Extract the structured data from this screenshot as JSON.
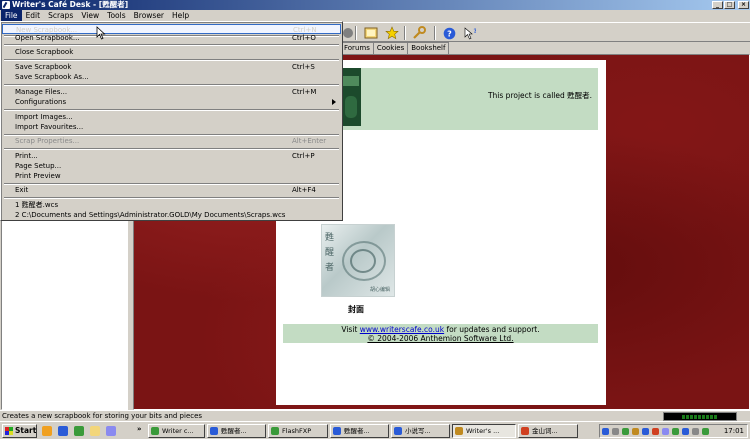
{
  "window": {
    "title": "Writer's Café Desk - [甦醒者]",
    "minimize": "_",
    "maximize": "□",
    "close": "×"
  },
  "menubar": [
    "File",
    "Edit",
    "Scraps",
    "View",
    "Tools",
    "Browser",
    "Help"
  ],
  "toolbar": {
    "icons": [
      "new-icon",
      "note-icon",
      "star-icon",
      "wrench-icon",
      "help-icon",
      "whats-this-icon"
    ]
  },
  "tabs": [
    "Forums",
    "Cookies",
    "Bookshelf"
  ],
  "file_menu": {
    "items": [
      {
        "label": "New Scrapbook...",
        "shortcut": "Ctrl+N"
      },
      {
        "label": "Open Scrapbook...",
        "shortcut": "Ctrl+O"
      },
      {
        "label": "Close Scrapbook",
        "shortcut": ""
      },
      {
        "label": "Save Scrapbook",
        "shortcut": "Ctrl+S"
      },
      {
        "label": "Save Scrapbook As...",
        "shortcut": ""
      },
      {
        "label": "Manage Files...",
        "shortcut": "Ctrl+M"
      },
      {
        "label": "Configurations",
        "shortcut": ""
      },
      {
        "label": "Import Images...",
        "shortcut": ""
      },
      {
        "label": "Import Favourites...",
        "shortcut": ""
      },
      {
        "label": "Scrap Properties...",
        "shortcut": "Alt+Enter"
      },
      {
        "label": "Print...",
        "shortcut": "Ctrl+P"
      },
      {
        "label": "Page Setup...",
        "shortcut": ""
      },
      {
        "label": "Print Preview",
        "shortcut": ""
      },
      {
        "label": "Exit",
        "shortcut": "Alt+F4"
      },
      {
        "label": "1 甦醒者.wcs",
        "shortcut": ""
      },
      {
        "label": "2 C:\\Documents and Settings\\Administrator.GOLD\\My Documents\\Scraps.wcs",
        "shortcut": ""
      }
    ]
  },
  "page": {
    "project_text": "This project is called 甦醒者.",
    "cover_chars": "甦醒者",
    "cover_small": "胡心编辑",
    "cover_caption": "封面",
    "visit_prefix": "Visit ",
    "visit_link": "www.writerscafe.co.uk",
    "visit_suffix": " for updates and support.",
    "copyright": "© 2004-2006 Anthemion Software Ltd."
  },
  "statusbar": {
    "text": "Creates a new scrapbook for storing your bits and pieces"
  },
  "taskbar": {
    "start": "Start",
    "chevron": "»",
    "buttons": [
      "Writer c...",
      "甦醒者...",
      "FlashFXP",
      "甦醒者...",
      "小说写...",
      "Writer's ...",
      "金山词..."
    ],
    "clock": "17:01"
  }
}
